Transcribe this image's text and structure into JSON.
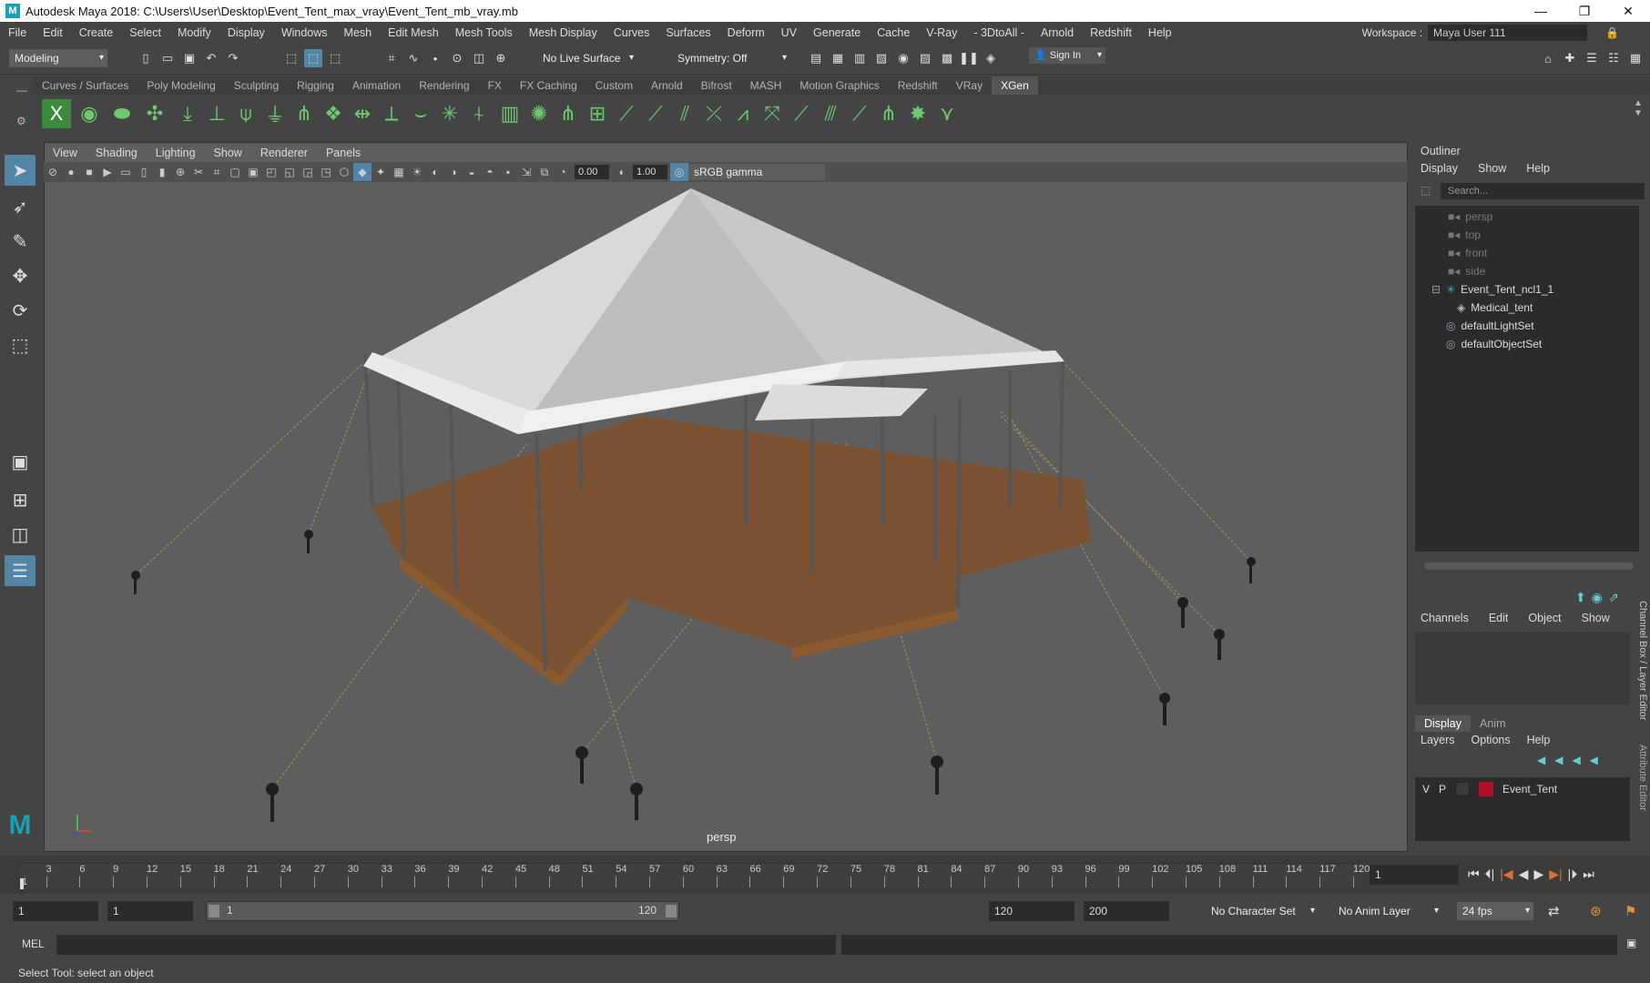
{
  "window": {
    "title": "Autodesk Maya 2018: C:\\Users\\User\\Desktop\\Event_Tent_max_vray\\Event_Tent_mb_vray.mb",
    "app_icon": "M"
  },
  "menu": [
    "File",
    "Edit",
    "Create",
    "Select",
    "Modify",
    "Display",
    "Windows",
    "Mesh",
    "Edit Mesh",
    "Mesh Tools",
    "Mesh Display",
    "Curves",
    "Surfaces",
    "Deform",
    "UV",
    "Generate",
    "Cache",
    "V-Ray",
    "- 3DtoAll -",
    "Arnold",
    "Redshift",
    "Help"
  ],
  "workspace": {
    "label": "Workspace :",
    "value": "Maya User 111"
  },
  "status": {
    "mode": "Modeling",
    "live_surface": "No Live Surface",
    "symmetry": "Symmetry: Off",
    "sign_in": "Sign In"
  },
  "shelf_tabs": [
    "Curves / Surfaces",
    "Poly Modeling",
    "Sculpting",
    "Rigging",
    "Animation",
    "Rendering",
    "FX",
    "FX Caching",
    "Custom",
    "Arnold",
    "Bifrost",
    "MASH",
    "Motion Graphics",
    "Redshift",
    "VRay",
    "XGen"
  ],
  "active_shelf": "XGen",
  "viewport": {
    "menu": [
      "View",
      "Shading",
      "Lighting",
      "Show",
      "Renderer",
      "Panels"
    ],
    "exposure": "0.00",
    "gamma_value": "1.00",
    "color_space": "sRGB gamma",
    "camera": "persp"
  },
  "outliner": {
    "title": "Outliner",
    "menu": [
      "Display",
      "Show",
      "Help"
    ],
    "search_placeholder": "Search...",
    "items": [
      "persp",
      "top",
      "front",
      "side",
      "Event_Tent_ncl1_1",
      "Medical_tent",
      "defaultLightSet",
      "defaultObjectSet"
    ]
  },
  "channel_box": {
    "menu": [
      "Channels",
      "Edit",
      "Object",
      "Show"
    ],
    "side_label": "Channel Box / Layer Editor",
    "attr_label": "Attribute Editor"
  },
  "layer_editor": {
    "tabs": [
      "Display",
      "Anim"
    ],
    "menu": [
      "Layers",
      "Options",
      "Help"
    ],
    "layer": {
      "v": "V",
      "p": "P",
      "name": "Event_Tent",
      "color": "#b0102a"
    }
  },
  "timeline": {
    "ticks": [
      "3",
      "6",
      "9",
      "12",
      "15",
      "18",
      "21",
      "24",
      "27",
      "30",
      "33",
      "36",
      "39",
      "42",
      "45",
      "48",
      "51",
      "54",
      "57",
      "60",
      "63",
      "66",
      "69",
      "72",
      "75",
      "78",
      "81",
      "84",
      "87",
      "90",
      "93",
      "96",
      "99",
      "102",
      "105",
      "108",
      "111",
      "114",
      "117",
      "120"
    ],
    "start_marker": "1",
    "current_frame": "1"
  },
  "range": {
    "start": "1",
    "anim_start": "1",
    "slider_start": "1",
    "slider_end": "120",
    "end": "120",
    "anim_end": "200",
    "character_set": "No Character Set",
    "anim_layer": "No Anim Layer",
    "fps": "24 fps"
  },
  "command": {
    "lang": "MEL"
  },
  "help_line": "Select Tool: select an object"
}
